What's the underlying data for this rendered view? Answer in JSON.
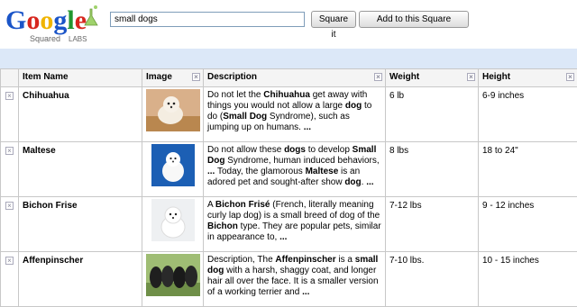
{
  "logo": {
    "main": "Google",
    "sub": "Squared",
    "labs": "LABS"
  },
  "search": {
    "value": "small dogs"
  },
  "buttons": {
    "square_it": "Square it",
    "add_to_square": "Add to this Square"
  },
  "columns": [
    {
      "label": ""
    },
    {
      "label": "Item Name"
    },
    {
      "label": "Image"
    },
    {
      "label": "Description"
    },
    {
      "label": "Weight"
    },
    {
      "label": "Height"
    }
  ],
  "rows": [
    {
      "name": "Chihuahua",
      "image": "chihuahua-photo",
      "description": [
        {
          "t": "Do not let the ",
          "b": false
        },
        {
          "t": "Chihuahua",
          "b": true
        },
        {
          "t": " get away with things you would not allow a large ",
          "b": false
        },
        {
          "t": "dog",
          "b": true
        },
        {
          "t": " to do (",
          "b": false
        },
        {
          "t": "Small Dog",
          "b": true
        },
        {
          "t": " Syndrome), such as jumping up on humans. ",
          "b": false
        },
        {
          "t": "...",
          "b": true
        }
      ],
      "weight": "6 lb",
      "height": "6-9 inches"
    },
    {
      "name": "Maltese",
      "image": "maltese-photo",
      "description": [
        {
          "t": "Do not allow these ",
          "b": false
        },
        {
          "t": "dogs",
          "b": true
        },
        {
          "t": " to develop ",
          "b": false
        },
        {
          "t": "Small Dog",
          "b": true
        },
        {
          "t": " Syndrome, human induced behaviors, ",
          "b": false
        },
        {
          "t": "...",
          "b": true
        },
        {
          "t": " Today, the glamorous ",
          "b": false
        },
        {
          "t": "Maltese",
          "b": true
        },
        {
          "t": " is an adored pet and sought-after show ",
          "b": false
        },
        {
          "t": "dog",
          "b": true
        },
        {
          "t": ". ",
          "b": false
        },
        {
          "t": "...",
          "b": true
        }
      ],
      "weight": "8 lbs",
      "height": "18 to 24\""
    },
    {
      "name": "Bichon Frise",
      "image": "bichon-frise-photo",
      "description": [
        {
          "t": "A ",
          "b": false
        },
        {
          "t": "Bichon Frisé",
          "b": true
        },
        {
          "t": " (French, literally meaning curly lap dog) is a small breed of dog of the ",
          "b": false
        },
        {
          "t": "Bichon",
          "b": true
        },
        {
          "t": " type. They are popular pets, similar in appearance to, ",
          "b": false
        },
        {
          "t": "...",
          "b": true
        }
      ],
      "weight": "7-12 lbs",
      "height": "9 - 12 inches"
    },
    {
      "name": "Affenpinscher",
      "image": "affenpinscher-photo",
      "description": [
        {
          "t": "Description, The ",
          "b": false
        },
        {
          "t": "Affenpinscher",
          "b": true
        },
        {
          "t": " is a ",
          "b": false
        },
        {
          "t": "small dog",
          "b": true
        },
        {
          "t": " with a harsh, shaggy coat, and longer hair all over the face. It is a smaller version of a working terrier and ",
          "b": false
        },
        {
          "t": "...",
          "b": true
        }
      ],
      "weight": "7-10 lbs.",
      "height": "10 - 15 inches"
    }
  ],
  "icons": {
    "remove": "close-icon"
  },
  "colors": {
    "band": "#dce8f8",
    "header_bg": "#f4f4f4",
    "border": "#c8c8c8"
  }
}
